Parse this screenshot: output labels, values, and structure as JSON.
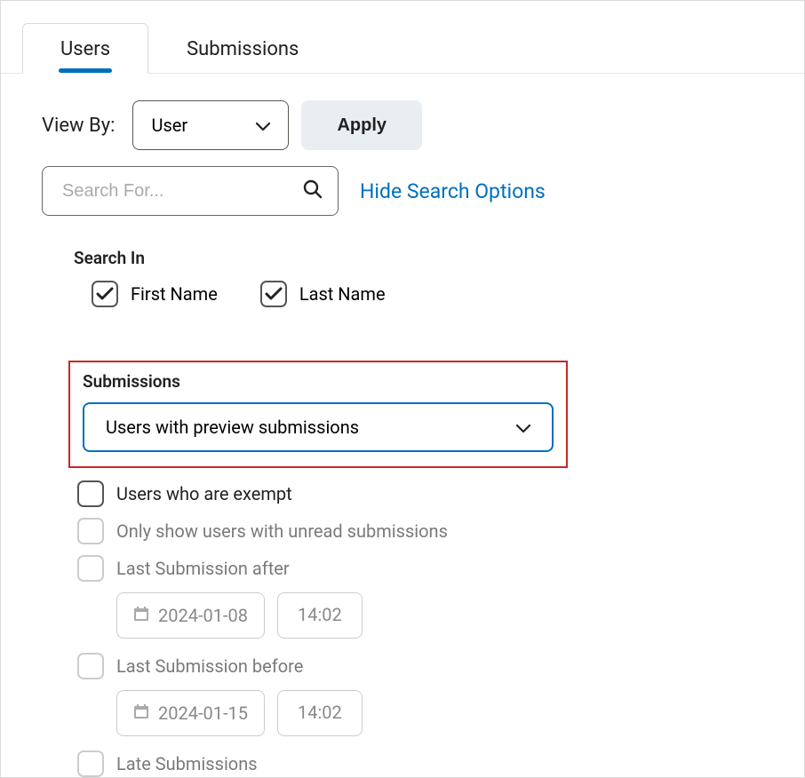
{
  "tabs": {
    "users": "Users",
    "submissions": "Submissions"
  },
  "viewby": {
    "label": "View By:",
    "selected": "User"
  },
  "apply": "Apply",
  "search": {
    "placeholder": "Search For...",
    "hide_options": "Hide Search Options"
  },
  "search_in": {
    "label": "Search In",
    "first_name": "First Name",
    "last_name": "Last Name"
  },
  "submissions": {
    "label": "Submissions",
    "selected": "Users with preview submissions"
  },
  "filters": {
    "exempt": "Users who are exempt",
    "unread": "Only show users with unread submissions",
    "after": "Last Submission after",
    "after_date": "2024-01-08",
    "after_time": "14:02",
    "before": "Last Submission before",
    "before_date": "2024-01-15",
    "before_time": "14:02",
    "late": "Late Submissions"
  },
  "colors": {
    "accent": "#006fbf",
    "highlight": "#c62828"
  }
}
